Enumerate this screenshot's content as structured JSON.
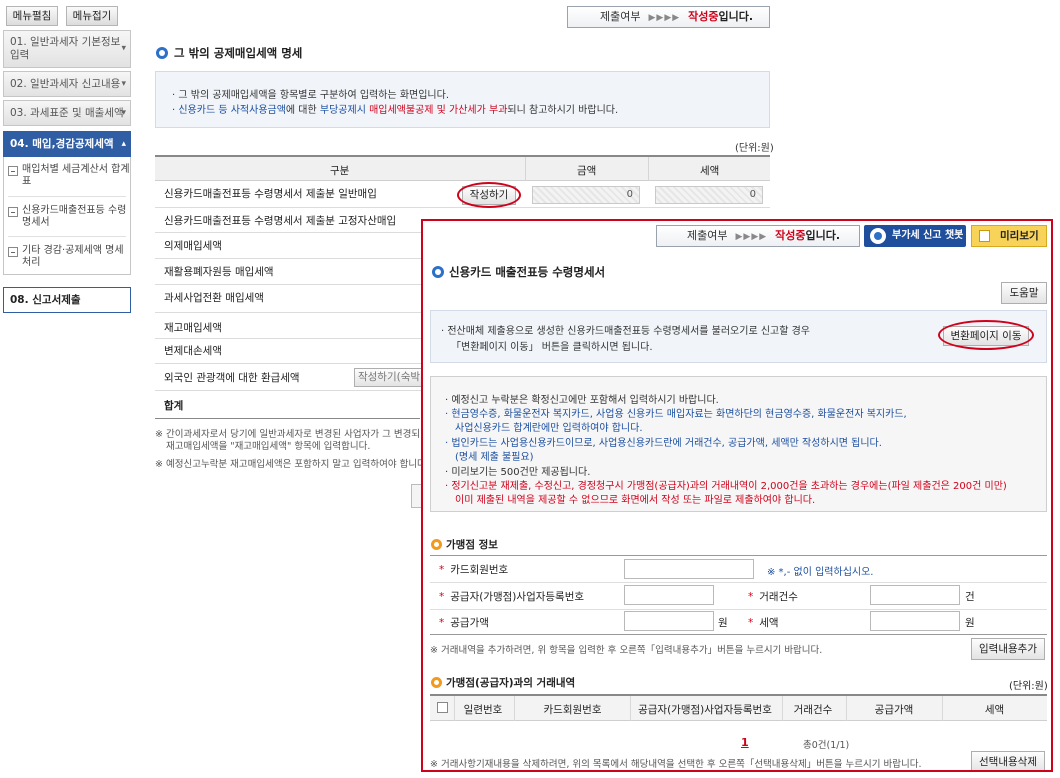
{
  "sidebar": {
    "btn_edit": "메뉴펼침",
    "btn_fold": "메뉴접기",
    "items": [
      {
        "label": "01. 일반과세자 기본정보 입력"
      },
      {
        "label": "02. 일반과세자 신고내용"
      },
      {
        "label": "03. 과세표준 및 매출세액"
      },
      {
        "label": "04. 매입,경감공제세액"
      },
      {
        "label": "08. 신고서제출"
      }
    ],
    "subitems": [
      {
        "label": "매입처별 세금계산서 합계표"
      },
      {
        "label": "신용카드매출전표등 수령명세서"
      },
      {
        "label": "기타 경감·공제세액 명세 처리"
      }
    ]
  },
  "status": {
    "label": "제출여부",
    "arrow": "▶▶▶▶",
    "value": "작성중",
    "suffix": "입니다."
  },
  "main": {
    "title": "그 밖의 공제매입세액 명세",
    "info1": "그 밖의 공제매입세액을 항목별로 구분하여 입력하는 화면입니다.",
    "info2_a": "신용카드 등 사적사용금액",
    "info2_b": "에 대한 ",
    "info2_c": "부당공제시 ",
    "info2_d": "매입세액불공제 및 가산세가 부과",
    "info2_e": "되니 참고하시기 바랍니다.",
    "unit": "(단위:원)",
    "headers": {
      "col1": "구분",
      "col2": "금액",
      "col3": "세액"
    },
    "rows": [
      {
        "label": "신용카드매출전표등 수령명세서 제출분 일반매입",
        "btn": "작성하기",
        "amount": "0",
        "tax": "0"
      },
      {
        "label": "신용카드매출전표등 수령명세서 제출분 고정자산매입"
      },
      {
        "label": "의제매입세액"
      },
      {
        "label": "재활용폐자원등 매입세액"
      },
      {
        "label": "과세사업전환 매입세액"
      },
      {
        "label": "재고매입세액"
      },
      {
        "label": "변제대손세액"
      },
      {
        "label": "외국인 관광객에 대한 환급세액",
        "btn": "작성하기(숙박"
      },
      {
        "label": "합계"
      }
    ],
    "note1a": "※ 간이과세자로서 당기에 일반과세자로 변경된 사업자가 그 변경되",
    "note1b": "재고매입세액을 \"재고매입세액\" 항목에 입력합니다.",
    "note2": "※ 예정신고누락분 재고매입세액은 포함하지 말고 입력하여야 합니다."
  },
  "popup": {
    "status": {
      "label": "제출여부",
      "arrow": "▶▶▶▶",
      "value": "작성중",
      "suffix": "입니다."
    },
    "chatbot": "부가세 신고 챗봇",
    "preview": "미리보기",
    "title": "신용카드 매출전표등 수령명세서",
    "help": "도움말",
    "convert_line1": "전산매체 제출용으로 생성한 신용카드매출전표등 수령명세서를 불러오기로 신고할 경우",
    "convert_line2": "「변환페이지 이동」 버튼을 클릭하시면 됩니다.",
    "convert_btn": "변환페이지 이동",
    "notes": [
      {
        "text": "예정신고 누락분은 확정신고에만 포함해서 입력하시기 바랍니다.",
        "color": "#333333"
      },
      {
        "text": "현금영수증, 화물운전자 복지카드, 사업용 신용카드 매입자료는 화면하단의 현금영수증, 화물운전자 복지카드,",
        "color": "#1c4fa0"
      },
      {
        "text": "사업신용카드 합계란에만 입력하여야 합니다.",
        "color": "#1c4fa0"
      },
      {
        "text": "법인카드는 사업용신용카드이므로, 사업용신용카드란에 거래건수, 공급가액, 세액만 작성하시면 됩니다.",
        "color": "#1c4fa0"
      },
      {
        "text": "(명세 제출 불필요)",
        "color": "#1c4fa0"
      },
      {
        "text": "미리보기는 500건만 제공됩니다.",
        "color": "#333333"
      },
      {
        "text": "정기신고분 재제출, 수정신고, 경정청구시 가맹점(공급자)과의 거래내역이 2,000건을 초과하는 경우에는(파일 제출건은 200건 미만)",
        "color": "#d0021b"
      },
      {
        "text": "이미 제출된 내역을 제공할 수 없으므로 화면에서 작성 또는 파일로 제출하여야 합니다.",
        "color": "#d0021b"
      }
    ],
    "section1": "가맹점 정보",
    "card_no_label": "카드회원번호",
    "card_no_hint": "※ *,- 없이 입력하십시오.",
    "biz_no_label": "공급자(가맹점)사업자등록번호",
    "count_label": "거래건수",
    "count_unit": "건",
    "supply_label": "공급가액",
    "supply_unit": "원",
    "tax_label": "세액",
    "tax_unit": "원",
    "add_note": "※ 거래내역을 추가하려면, 위 항목을 입력한 후 오른쪽「입력내용추가」버튼을 누르시기 바랍니다.",
    "add_btn": "입력내용추가",
    "section2": "가맹점(공급자)과의 거래내역",
    "unit": "(단위:원)",
    "headers": [
      "일련번호",
      "카드회원번호",
      "공급자(가맹점)사업자등록번호",
      "거래건수",
      "공급가액",
      "세액"
    ],
    "page": "1",
    "total": "총0건(1/1)",
    "del_note": "※ 거래사항기재내용을 삭제하려면, 위의 목록에서 해당내역을 선택한 후 오른쪽「선택내용삭제」버튼을 누르시기 바랍니다.",
    "del_btn": "선택내용삭제"
  }
}
